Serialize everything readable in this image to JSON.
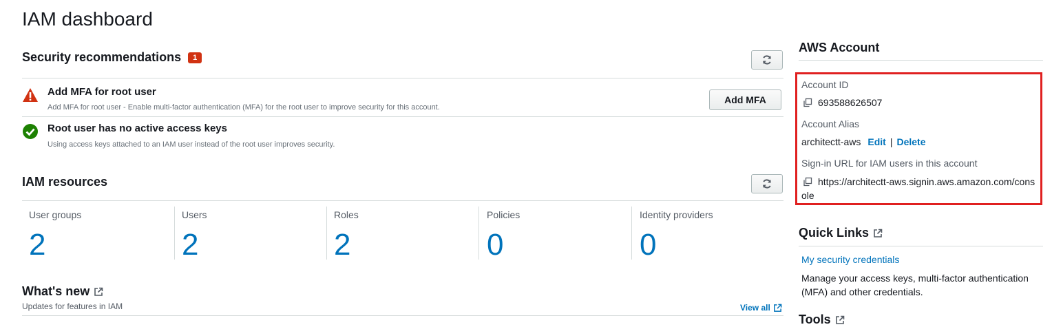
{
  "page": {
    "title": "IAM dashboard"
  },
  "security": {
    "title": "Security recommendations",
    "badge": "1",
    "recs": [
      {
        "title": "Add MFA for root user",
        "desc": "Add MFA for root user - Enable multi-factor authentication (MFA) for the root user to improve security for this account.",
        "status": "warning",
        "action": "Add MFA"
      },
      {
        "title": "Root user has no active access keys",
        "desc": "Using access keys attached to an IAM user instead of the root user improves security.",
        "status": "ok"
      }
    ]
  },
  "resources": {
    "title": "IAM resources",
    "items": [
      {
        "label": "User groups",
        "value": "2"
      },
      {
        "label": "Users",
        "value": "2"
      },
      {
        "label": "Roles",
        "value": "2"
      },
      {
        "label": "Policies",
        "value": "0"
      },
      {
        "label": "Identity providers",
        "value": "0"
      }
    ]
  },
  "whatsnew": {
    "title": "What's new",
    "subtitle": "Updates for features in IAM",
    "view_all": "View all"
  },
  "account": {
    "title": "AWS Account",
    "id_label": "Account ID",
    "id_value": "693588626507",
    "alias_label": "Account Alias",
    "alias_value": "architectt-aws",
    "edit": "Edit",
    "sep": "|",
    "delete": "Delete",
    "signin_label": "Sign-in URL for IAM users in this account",
    "signin_line1": "https://architectt-aws.signin.aws.amazon.com/cons",
    "signin_line2": "ole"
  },
  "quicklinks": {
    "title": "Quick Links",
    "link": "My security credentials",
    "desc": "Manage your access keys, multi-factor authentication (MFA) and other credentials."
  },
  "tools": {
    "title": "Tools"
  },
  "colors": {
    "link": "#0073bb",
    "danger": "#d13212",
    "success": "#1d8102",
    "highlight": "#e02020"
  }
}
